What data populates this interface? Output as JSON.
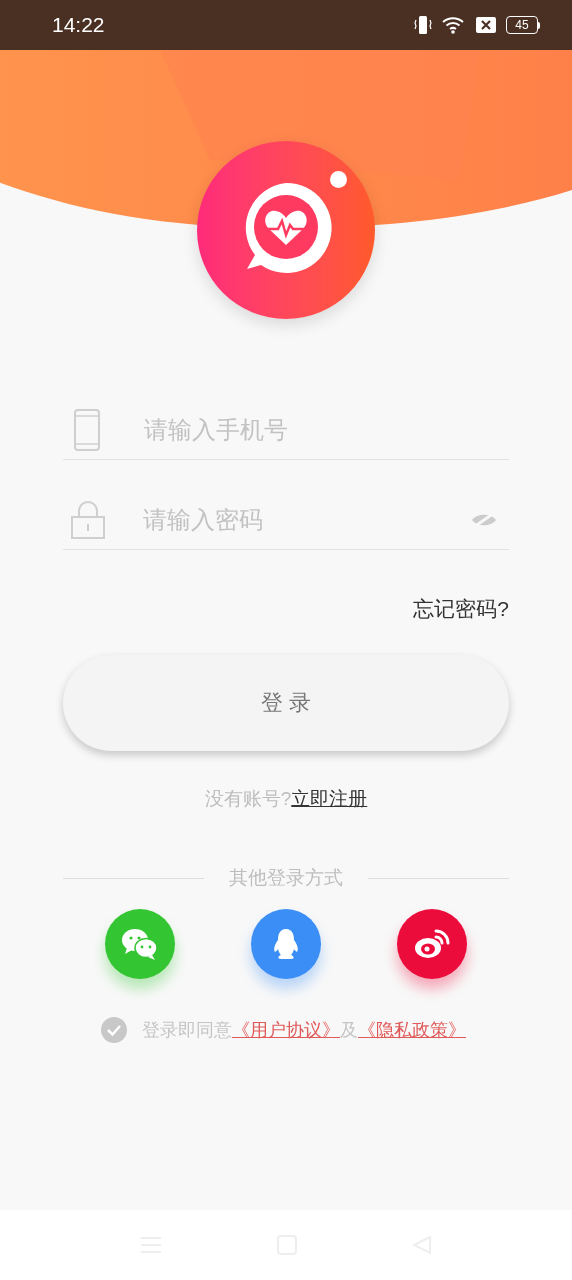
{
  "status_bar": {
    "time": "14:22",
    "battery": "45"
  },
  "phone_field": {
    "placeholder": "请输入手机号"
  },
  "password_field": {
    "placeholder": "请输入密码"
  },
  "forgot_link": "忘记密码?",
  "login_button": "登 录",
  "register": {
    "prompt": "没有账号?",
    "link": "立即注册"
  },
  "other_login": {
    "title": "其他登录方式",
    "providers": [
      {
        "kind": "wechat",
        "color": "#34c532"
      },
      {
        "kind": "qq",
        "color": "#3a8ef5"
      },
      {
        "kind": "weibo",
        "color": "#ec0c3c"
      }
    ]
  },
  "agreement": {
    "agreed": false,
    "text": "登录即同意",
    "link1": "《用户协议》",
    "joiner": "及",
    "link2": "《隐私政策》"
  }
}
